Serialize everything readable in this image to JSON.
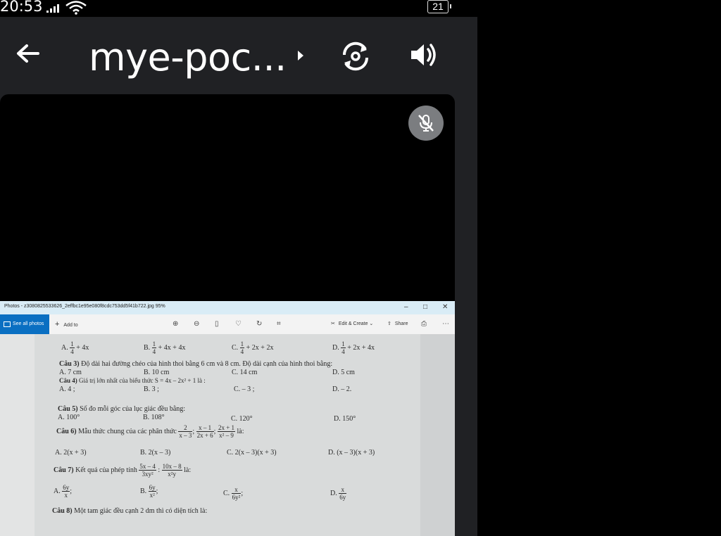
{
  "status": {
    "time": "20:53",
    "battery": "21"
  },
  "appbar": {
    "title": "mye-poc..."
  },
  "photos": {
    "title": "Photos - z3080825533626_2effbc1e95e080f8cdc753dd5f41b722.jpg  95%",
    "see_all": "See all photos",
    "add_to": "Add to",
    "edit_create": "Edit & Create",
    "share": "Share"
  },
  "doc": {
    "q2": {
      "a": "A.",
      "a2": "+ 4x",
      "b": "B.",
      "b2": "+ 4x + 4x",
      "c": "C.",
      "c2": "+ 2x + 2x",
      "d": "D.",
      "d2": "+ 2x + 4x"
    },
    "q3": {
      "head": "Câu 3)",
      "text": "Độ dài hai đường chéo của hình thoi bằng 6 cm và 8 cm. Độ dài cạnh của hình thoi bằng:",
      "a": "A.  7 cm",
      "b": "B.  10 cm",
      "c": "C.  14 cm",
      "d": "D.  5 cm"
    },
    "q4": {
      "head": "Câu 4)",
      "text": "Giá trị lớn nhất của biểu thức S = 4x – 2x² + 1 là :",
      "a": "A. 4 ;",
      "b": "B. 3 ;",
      "c": "C. – 3 ;",
      "d": "D. – 2."
    },
    "q5": {
      "head": "Câu 5)",
      "text": "Số đo mỗi góc của lục giác đều bằng:",
      "a": "A.  100°",
      "b": "B.   108°",
      "c": "C.  120°",
      "d": "D.   150°"
    },
    "q6": {
      "head": "Câu 6)",
      "text": "Mẫu thức chung của các phân thức",
      "f1n": "2",
      "f1d": "x – 3",
      "f2n": "x – 1",
      "f2d": "2x + 6",
      "f3n": "2x + 1",
      "f3d": "x² – 9",
      "tail": "là:",
      "a": "A. 2(x + 3)",
      "b": "B. 2(x – 3)",
      "c": "C. 2(x – 3)(x + 3)",
      "d": "D. (x – 3)(x + 3)"
    },
    "q7": {
      "head": "Câu 7)",
      "text": "Kết quả của phép tính",
      "f1n": "5x – 4",
      "f1d": "3xy²",
      "f2n": "10x – 8",
      "f2d": "x²y",
      "tail": "là:",
      "a": "A.",
      "an": "6y",
      "ad": "x",
      "b": "B.",
      "bn": "6y",
      "bd": "x²",
      "c": "C.",
      "cn": "x",
      "cd": "6y²",
      "d": "D.",
      "dn": "x",
      "dd": "6y"
    },
    "q8": {
      "head": "Câu 8)",
      "text": "Một tam giác đều cạnh 2 dm thì có diện tích là:"
    }
  }
}
